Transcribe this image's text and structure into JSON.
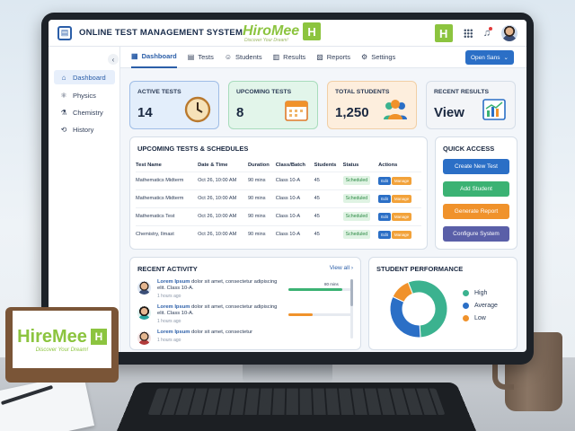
{
  "app": {
    "title": "ONLINE TEST MANAGEMENT SYSTEM",
    "brand_name": "HiroMee",
    "brand_tagline": "Discover Your Dream!",
    "brand_mark": "H"
  },
  "sign": {
    "name": "HireMee",
    "tagline": "Discover Your Dream!",
    "mark": "H"
  },
  "sidebar": {
    "items": [
      {
        "label": "Dashboard",
        "icon": "home-icon",
        "active": true
      },
      {
        "label": "Physics",
        "icon": "atom-icon",
        "active": false
      },
      {
        "label": "Chemistry",
        "icon": "flask-icon",
        "active": false
      },
      {
        "label": "History",
        "icon": "history-icon",
        "active": false
      }
    ]
  },
  "tabs": [
    {
      "label": "Dashboard",
      "icon": "dashboard-icon",
      "active": true
    },
    {
      "label": "Tests",
      "icon": "document-icon",
      "active": false
    },
    {
      "label": "Students",
      "icon": "users-icon",
      "active": false
    },
    {
      "label": "Results",
      "icon": "bar-chart-icon",
      "active": false
    },
    {
      "label": "Reports",
      "icon": "report-icon",
      "active": false
    },
    {
      "label": "Settings",
      "icon": "gear-icon",
      "active": false
    }
  ],
  "font_dropdown": {
    "value": "Open Sans"
  },
  "stats": [
    {
      "label": "ACTIVE TESTS",
      "value": "14",
      "bg": "#e3eefb",
      "border": "#9fbde6",
      "icon": "clock-icon"
    },
    {
      "label": "UPCOMING TESTS",
      "value": "8",
      "bg": "#e2f5ea",
      "border": "#a8dcbc",
      "icon": "calendar-icon"
    },
    {
      "label": "TOTAL STUDENTS",
      "value": "1,250",
      "bg": "#fdeedd",
      "border": "#f1cfa6",
      "icon": "group-icon"
    },
    {
      "label": "RECENT RESULTS",
      "value": "View",
      "bg": "#f3f5f8",
      "border": "#d6dee8",
      "icon": "report-chart-icon"
    }
  ],
  "upcoming": {
    "title": "UPCOMING TESTS & SCHEDULES",
    "headers": [
      "Test Name",
      "Date & Time",
      "Duration",
      "Class/Batch",
      "Students",
      "Status",
      "Actions"
    ],
    "rows": [
      {
        "name": "Mathematics Midterm",
        "date": "Oct 26, 10:00 AM",
        "duration": "90 mins",
        "class": "Class 10-A",
        "students": "45",
        "status": "Scheduled"
      },
      {
        "name": "Mathematics Midterm",
        "date": "Oct 26, 10:00 AM",
        "duration": "90 mins",
        "class": "Class 10-A",
        "students": "45",
        "status": "Scheduled"
      },
      {
        "name": "Mathematics Test",
        "date": "Oct 26, 10:00 AM",
        "duration": "90 mins",
        "class": "Class 10-A",
        "students": "45",
        "status": "Scheduled"
      },
      {
        "name": "Chemistry, Ilmast",
        "date": "Oct 26, 10:00 AM",
        "duration": "90 mins",
        "class": "Class 10-A",
        "students": "45",
        "status": "Scheduled"
      }
    ],
    "action_edit": "Edit",
    "action_manage": "Manage"
  },
  "quick_access": {
    "title": "QUICK ACCESS",
    "buttons": [
      {
        "label": "Create New Test",
        "color": "#2b6fc6"
      },
      {
        "label": "Add Student",
        "color": "#3bb273"
      },
      {
        "label": "Generate Report",
        "color": "#f0922b"
      },
      {
        "label": "Configure System",
        "color": "#5a5fa8"
      }
    ]
  },
  "activity": {
    "title": "RECENT ACTIVITY",
    "view_all": "View all",
    "items": [
      {
        "title": "Lorem Ipsum",
        "text": "dolor sit amet, consectetur adipiscing elit. Class 10-A.",
        "time": "1 hours ago",
        "bar_label": "80 mins",
        "bar_fraction": 0.86,
        "bar_color": "#3bb273"
      },
      {
        "title": "Lorem Ipsum",
        "text": "dolor sit amet, consectetur adipiscing elit. Class 10-A.",
        "time": "1 hours ago",
        "bar_label": "",
        "bar_fraction": 0.38,
        "bar_color": "#f0922b"
      },
      {
        "title": "Lorem Ipsum",
        "text": "dolor sit amet, consectetur",
        "time": "1 hours ago",
        "bar_label": "",
        "bar_fraction": 0,
        "bar_color": "#3bb273"
      }
    ]
  },
  "performance": {
    "title": "STUDENT PERFORMANCE",
    "legend": [
      {
        "label": "High",
        "color": "#3bb28f"
      },
      {
        "label": "Average",
        "color": "#2b6fc6"
      },
      {
        "label": "Low",
        "color": "#f0922b"
      }
    ],
    "chart_data": {
      "type": "pie",
      "categories": [
        "High",
        "Average",
        "Low"
      ],
      "values": [
        55,
        33,
        12
      ]
    }
  }
}
